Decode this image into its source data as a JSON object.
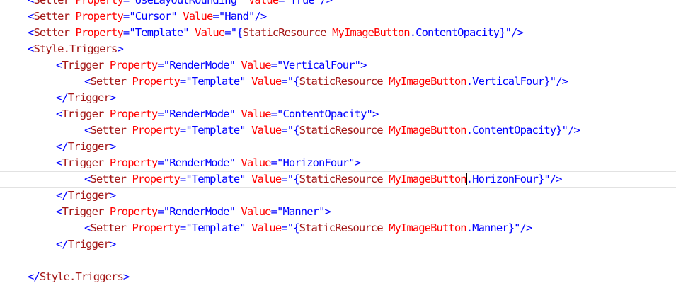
{
  "editor": {
    "lines": [
      {
        "indent": 1,
        "tokens": [
          {
            "t": "punct",
            "v": "<"
          },
          {
            "t": "tag",
            "v": "Setter"
          },
          {
            "t": "attr",
            "v": " Property"
          },
          {
            "t": "punct",
            "v": "=\""
          },
          {
            "t": "str",
            "v": "UseLayoutRounding"
          },
          {
            "t": "punct",
            "v": "\""
          },
          {
            "t": "attr",
            "v": " Value"
          },
          {
            "t": "punct",
            "v": "=\""
          },
          {
            "t": "str",
            "v": "True"
          },
          {
            "t": "punct",
            "v": "\"/>"
          }
        ]
      },
      {
        "indent": 1,
        "tokens": [
          {
            "t": "punct",
            "v": "<"
          },
          {
            "t": "tag",
            "v": "Setter"
          },
          {
            "t": "attr",
            "v": " Property"
          },
          {
            "t": "punct",
            "v": "=\""
          },
          {
            "t": "str",
            "v": "Cursor"
          },
          {
            "t": "punct",
            "v": "\""
          },
          {
            "t": "attr",
            "v": " Value"
          },
          {
            "t": "punct",
            "v": "=\""
          },
          {
            "t": "str",
            "v": "Hand"
          },
          {
            "t": "punct",
            "v": "\"/>"
          }
        ]
      },
      {
        "indent": 1,
        "tokens": [
          {
            "t": "punct",
            "v": "<"
          },
          {
            "t": "tag",
            "v": "Setter"
          },
          {
            "t": "attr",
            "v": " Property"
          },
          {
            "t": "punct",
            "v": "=\""
          },
          {
            "t": "str",
            "v": "Template"
          },
          {
            "t": "punct",
            "v": "\""
          },
          {
            "t": "attr",
            "v": " Value"
          },
          {
            "t": "punct",
            "v": "=\""
          },
          {
            "t": "punct",
            "v": "{"
          },
          {
            "t": "tag",
            "v": "StaticResource"
          },
          {
            "t": "attr",
            "v": " MyImageButton"
          },
          {
            "t": "str",
            "v": ".ContentOpacity"
          },
          {
            "t": "punct",
            "v": "}\"/>"
          }
        ]
      },
      {
        "indent": 1,
        "tokens": [
          {
            "t": "punct",
            "v": "<"
          },
          {
            "t": "tag",
            "v": "Style.Triggers"
          },
          {
            "t": "punct",
            "v": ">"
          }
        ]
      },
      {
        "indent": 2,
        "tokens": [
          {
            "t": "punct",
            "v": "<"
          },
          {
            "t": "tag",
            "v": "Trigger"
          },
          {
            "t": "attr",
            "v": " Property"
          },
          {
            "t": "punct",
            "v": "=\""
          },
          {
            "t": "str",
            "v": "RenderMode"
          },
          {
            "t": "punct",
            "v": "\""
          },
          {
            "t": "attr",
            "v": " Value"
          },
          {
            "t": "punct",
            "v": "=\""
          },
          {
            "t": "str",
            "v": "VerticalFour"
          },
          {
            "t": "punct",
            "v": "\">"
          }
        ]
      },
      {
        "indent": 3,
        "tokens": [
          {
            "t": "punct",
            "v": "<"
          },
          {
            "t": "tag",
            "v": "Setter"
          },
          {
            "t": "attr",
            "v": " Property"
          },
          {
            "t": "punct",
            "v": "=\""
          },
          {
            "t": "str",
            "v": "Template"
          },
          {
            "t": "punct",
            "v": "\""
          },
          {
            "t": "attr",
            "v": " Value"
          },
          {
            "t": "punct",
            "v": "=\""
          },
          {
            "t": "punct",
            "v": "{"
          },
          {
            "t": "tag",
            "v": "StaticResource"
          },
          {
            "t": "attr",
            "v": " MyImageButton"
          },
          {
            "t": "str",
            "v": ".VerticalFour"
          },
          {
            "t": "punct",
            "v": "}\"/>"
          }
        ]
      },
      {
        "indent": 2,
        "tokens": [
          {
            "t": "punct",
            "v": "</"
          },
          {
            "t": "tag",
            "v": "Trigger"
          },
          {
            "t": "punct",
            "v": ">"
          }
        ]
      },
      {
        "indent": 2,
        "tokens": [
          {
            "t": "punct",
            "v": "<"
          },
          {
            "t": "tag",
            "v": "Trigger"
          },
          {
            "t": "attr",
            "v": " Property"
          },
          {
            "t": "punct",
            "v": "=\""
          },
          {
            "t": "str",
            "v": "RenderMode"
          },
          {
            "t": "punct",
            "v": "\""
          },
          {
            "t": "attr",
            "v": " Value"
          },
          {
            "t": "punct",
            "v": "=\""
          },
          {
            "t": "str",
            "v": "ContentOpacity"
          },
          {
            "t": "punct",
            "v": "\">"
          }
        ]
      },
      {
        "indent": 3,
        "tokens": [
          {
            "t": "punct",
            "v": "<"
          },
          {
            "t": "tag",
            "v": "Setter"
          },
          {
            "t": "attr",
            "v": " Property"
          },
          {
            "t": "punct",
            "v": "=\""
          },
          {
            "t": "str",
            "v": "Template"
          },
          {
            "t": "punct",
            "v": "\""
          },
          {
            "t": "attr",
            "v": " Value"
          },
          {
            "t": "punct",
            "v": "=\""
          },
          {
            "t": "punct",
            "v": "{"
          },
          {
            "t": "tag",
            "v": "StaticResource"
          },
          {
            "t": "attr",
            "v": " MyImageButton"
          },
          {
            "t": "str",
            "v": ".ContentOpacity"
          },
          {
            "t": "punct",
            "v": "}\"/>"
          }
        ]
      },
      {
        "indent": 2,
        "tokens": [
          {
            "t": "punct",
            "v": "</"
          },
          {
            "t": "tag",
            "v": "Trigger"
          },
          {
            "t": "punct",
            "v": ">"
          }
        ]
      },
      {
        "indent": 2,
        "tokens": [
          {
            "t": "punct",
            "v": "<"
          },
          {
            "t": "tag",
            "v": "Trigger"
          },
          {
            "t": "attr",
            "v": " Property"
          },
          {
            "t": "punct",
            "v": "=\""
          },
          {
            "t": "str",
            "v": "RenderMode"
          },
          {
            "t": "punct",
            "v": "\""
          },
          {
            "t": "attr",
            "v": " Value"
          },
          {
            "t": "punct",
            "v": "=\""
          },
          {
            "t": "str",
            "v": "HorizonFour"
          },
          {
            "t": "punct",
            "v": "\">"
          }
        ]
      },
      {
        "indent": 3,
        "current": true,
        "tokens": [
          {
            "t": "punct",
            "v": "<"
          },
          {
            "t": "tag",
            "v": "Setter"
          },
          {
            "t": "attr",
            "v": " Property"
          },
          {
            "t": "punct",
            "v": "=\""
          },
          {
            "t": "str",
            "v": "Template"
          },
          {
            "t": "punct",
            "v": "\""
          },
          {
            "t": "attr",
            "v": " Value"
          },
          {
            "t": "punct",
            "v": "=\""
          },
          {
            "t": "punct",
            "v": "{"
          },
          {
            "t": "tag",
            "v": "StaticResource"
          },
          {
            "t": "attr",
            "v": " MyImageButton"
          },
          {
            "t": "caret",
            "v": ""
          },
          {
            "t": "str",
            "v": ".HorizonFour"
          },
          {
            "t": "punct",
            "v": "}\"/>"
          }
        ]
      },
      {
        "indent": 2,
        "tokens": [
          {
            "t": "punct",
            "v": "</"
          },
          {
            "t": "tag",
            "v": "Trigger"
          },
          {
            "t": "punct",
            "v": ">"
          }
        ]
      },
      {
        "indent": 2,
        "tokens": [
          {
            "t": "punct",
            "v": "<"
          },
          {
            "t": "tag",
            "v": "Trigger"
          },
          {
            "t": "attr",
            "v": " Property"
          },
          {
            "t": "punct",
            "v": "=\""
          },
          {
            "t": "str",
            "v": "RenderMode"
          },
          {
            "t": "punct",
            "v": "\""
          },
          {
            "t": "attr",
            "v": " Value"
          },
          {
            "t": "punct",
            "v": "=\""
          },
          {
            "t": "str",
            "v": "Manner"
          },
          {
            "t": "punct",
            "v": "\">"
          }
        ]
      },
      {
        "indent": 3,
        "tokens": [
          {
            "t": "punct",
            "v": "<"
          },
          {
            "t": "tag",
            "v": "Setter"
          },
          {
            "t": "attr",
            "v": " Property"
          },
          {
            "t": "punct",
            "v": "=\""
          },
          {
            "t": "str",
            "v": "Template"
          },
          {
            "t": "punct",
            "v": "\""
          },
          {
            "t": "attr",
            "v": " Value"
          },
          {
            "t": "punct",
            "v": "=\""
          },
          {
            "t": "punct",
            "v": "{"
          },
          {
            "t": "tag",
            "v": "StaticResource"
          },
          {
            "t": "attr",
            "v": " MyImageButton"
          },
          {
            "t": "str",
            "v": ".Manner"
          },
          {
            "t": "punct",
            "v": "}\"/>"
          }
        ]
      },
      {
        "indent": 2,
        "tokens": [
          {
            "t": "punct",
            "v": "</"
          },
          {
            "t": "tag",
            "v": "Trigger"
          },
          {
            "t": "punct",
            "v": ">"
          }
        ]
      },
      {
        "indent": 0,
        "tokens": []
      },
      {
        "indent": 1,
        "tokens": [
          {
            "t": "punct",
            "v": "</"
          },
          {
            "t": "tag",
            "v": "Style.Triggers"
          },
          {
            "t": "punct",
            "v": ">"
          }
        ]
      }
    ]
  },
  "colors": {
    "punctuation": "#0000ff",
    "element_name": "#a31515",
    "attribute_name": "#ff0000",
    "attribute_value": "#0000ff",
    "current_line_border": "#e2e2e2",
    "background": "#ffffff"
  }
}
